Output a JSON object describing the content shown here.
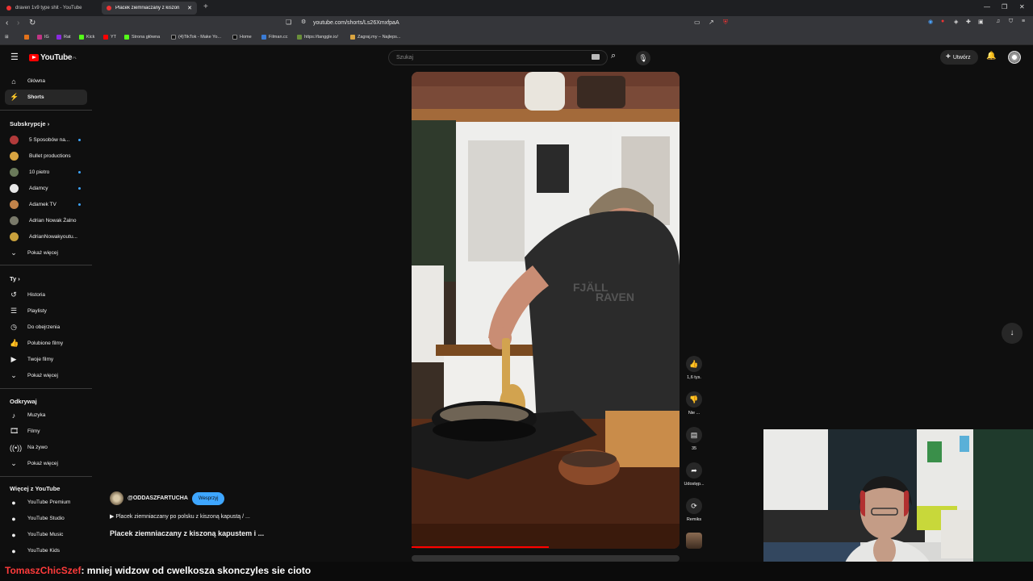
{
  "browser": {
    "tabs": [
      {
        "title": "draven 1v9 type shit - YouTube",
        "active": false
      },
      {
        "title": "Placek ziemniaczany z kiszon...",
        "active": true
      }
    ],
    "url": "youtube.com/shorts/Ls26XmxfpaA",
    "bookmarks": [
      "IG",
      "Rat",
      "Kick",
      "YT",
      "Strona główna",
      "(4)TikTok - Make Yo...",
      "Home",
      "Filman.cc",
      "https://tanggle.io/",
      "Zagraj.my – Najleps..."
    ]
  },
  "youtube": {
    "logo": "YouTube",
    "logo_region": "PL",
    "search_placeholder": "Szukaj",
    "create_label": "Utwórz",
    "colors": {
      "brand": "#ff0000",
      "accent": "#3ea6ff",
      "bg": "#0f0f0f"
    }
  },
  "sidebar": {
    "main": [
      {
        "label": "Główna",
        "icon": "home-icon"
      },
      {
        "label": "Shorts",
        "icon": "shorts-icon",
        "selected": true
      }
    ],
    "subs_header": "Subskrypcje",
    "subscriptions": [
      {
        "label": "5 Sposobów na...",
        "color": "#b23a3a",
        "dot": true
      },
      {
        "label": "Bullet productions",
        "color": "#d9a441",
        "dot": false
      },
      {
        "label": "10 pietro",
        "color": "#6a7a5a",
        "dot": true
      },
      {
        "label": "Adamcy",
        "color": "#e8e8e8",
        "dot": true
      },
      {
        "label": "Adamek TV",
        "color": "#c2834a",
        "dot": true
      },
      {
        "label": "Adrian Nowak Żalno",
        "color": "#7a7a6a",
        "dot": false
      },
      {
        "label": "AdrianNowakyoutu...",
        "color": "#c9a13c",
        "dot": false
      }
    ],
    "subs_more": "Pokaż więcej",
    "you_header": "Ty",
    "you_items": [
      {
        "label": "Historia",
        "icon": "history-icon"
      },
      {
        "label": "Playlisty",
        "icon": "playlists-icon"
      },
      {
        "label": "Do obejrzenia",
        "icon": "watch-later-icon"
      },
      {
        "label": "Polubione filmy",
        "icon": "liked-icon"
      },
      {
        "label": "Twoje filmy",
        "icon": "your-videos-icon"
      }
    ],
    "you_more": "Pokaż więcej",
    "explore_header": "Odkrywaj",
    "explore_items": [
      {
        "label": "Muzyka",
        "icon": "music-icon"
      },
      {
        "label": "Filmy",
        "icon": "movies-icon"
      },
      {
        "label": "Na żywo",
        "icon": "live-icon"
      }
    ],
    "explore_more": "Pokaż więcej",
    "more_header": "Więcej z YouTube",
    "more_items": [
      {
        "label": "YouTube Premium"
      },
      {
        "label": "YouTube Studio"
      },
      {
        "label": "YouTube Music"
      },
      {
        "label": "YouTube Kids"
      }
    ]
  },
  "short": {
    "channel": "@ODDASZFARTUCHA",
    "support_label": "Wesprzyj",
    "description": "▶ Placek ziemniaczany po polsku z kiszoną kapustą / ...",
    "title": "Placek ziemniaczany z kiszoną kapustem i ...",
    "progress": 0.5,
    "actions": [
      {
        "icon": "like-icon",
        "label": "1,6 tys."
      },
      {
        "icon": "dislike-icon",
        "label": "Nie ..."
      },
      {
        "icon": "comment-icon",
        "label": "35"
      },
      {
        "icon": "share-icon",
        "label": "Udostęp..."
      },
      {
        "icon": "remix-icon",
        "label": "Remiks"
      }
    ],
    "shirt_text": "FJÄLL RAVEN"
  },
  "chat": {
    "user": "TomaszChicSzef",
    "message": ": mniej widzow od cwelkosza skonczyles sie cioto"
  }
}
